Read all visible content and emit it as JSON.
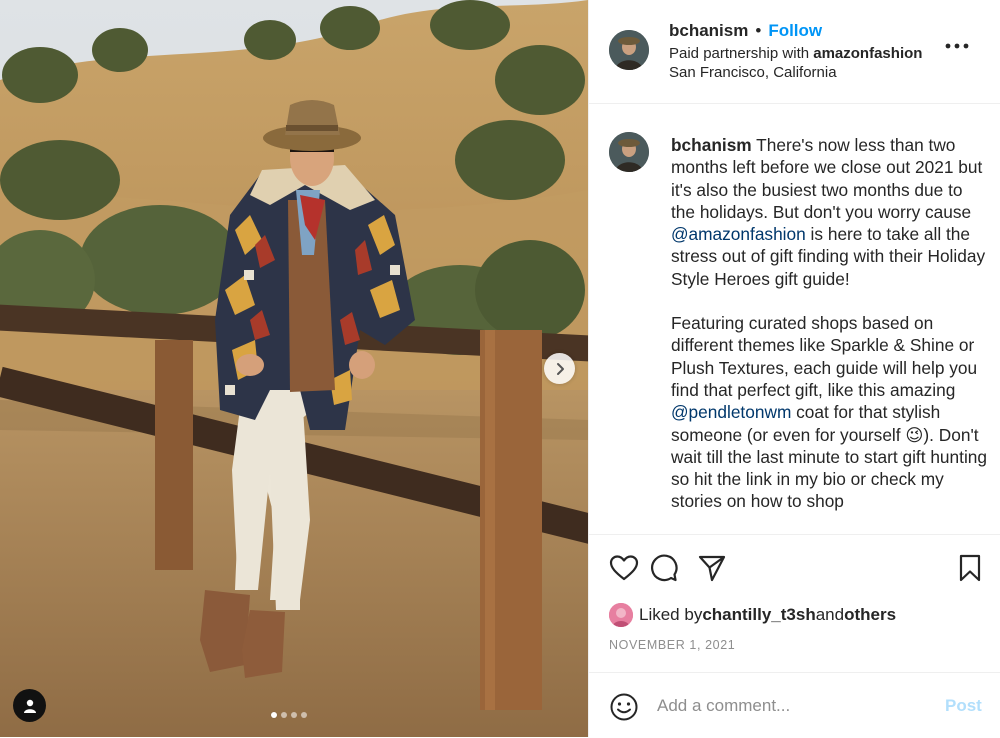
{
  "post": {
    "username": "bchanism",
    "follow_label": "Follow",
    "partnership_prefix": "Paid partnership with ",
    "partner": "amazonfashion",
    "location": "San Francisco, California",
    "more_icon": "more-options-icon"
  },
  "caption": {
    "username": "bchanism",
    "p1_a": " There's now less than two months left before we close out 2021 but it's also the busiest two months due to the holidays. But don't you worry cause ",
    "mention1": "@amazonfashion",
    "p1_b": " is here to take all the stress out of gift finding with their Holiday Style Heroes gift guide!",
    "p2_a": "Featuring curated shops based on different themes like Sparkle & Shine or Plush Textures, each guide will help you find that perfect gift, like this amazing ",
    "mention2": "@pendletonwm",
    "p2_b": " coat for that stylish someone (or even for yourself 😉). Don't wait till the last minute to start gift hunting so hit the link in my bio or check my stories on how to shop"
  },
  "actions": {
    "like_icon": "heart-icon",
    "comment_icon": "comment-icon",
    "share_icon": "share-icon",
    "save_icon": "bookmark-icon"
  },
  "likes": {
    "prefix": "Liked by ",
    "user": "chantilly_t3sh",
    "and": " and ",
    "others": "others"
  },
  "date": "NOVEMBER 1, 2021",
  "comment": {
    "placeholder": "Add a comment...",
    "post_label": "Post"
  },
  "carousel": {
    "slide_count": 4,
    "active_index": 0
  },
  "colors": {
    "accent": "#0095f6",
    "mention": "#00376b",
    "muted": "#8e8e8e",
    "post_disabled": "#b2dffc"
  }
}
